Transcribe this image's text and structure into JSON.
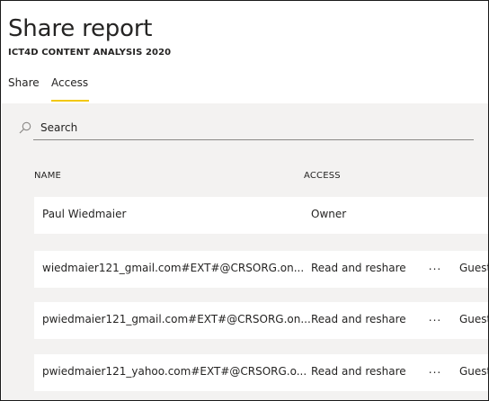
{
  "dialog": {
    "title": "Share report",
    "subtitle": "ICT4D CONTENT ANALYSIS 2020"
  },
  "tabs": [
    {
      "label": "Share",
      "active": false
    },
    {
      "label": "Access",
      "active": true
    }
  ],
  "search": {
    "placeholder": "Search",
    "value": ""
  },
  "table": {
    "headers": {
      "name": "NAME",
      "access": "ACCESS"
    },
    "rows": [
      {
        "name": "Paul Wiedmaier",
        "access": "Owner",
        "more": "",
        "type": ""
      },
      {
        "name": "wiedmaier121_gmail.com#EXT#@CRSORG.on...",
        "access": "Read and reshare",
        "more": "...",
        "type": "Guest"
      },
      {
        "name": "pwiedmaier121_gmail.com#EXT#@CRSORG.on...",
        "access": "Read and reshare",
        "more": "...",
        "type": "Guest"
      },
      {
        "name": "pwiedmaier121_yahoo.com#EXT#@CRSORG.o...",
        "access": "Read and reshare",
        "more": "...",
        "type": "Guest"
      }
    ]
  },
  "colors": {
    "accent": "#f2c811",
    "panel": "#f3f2f1"
  }
}
